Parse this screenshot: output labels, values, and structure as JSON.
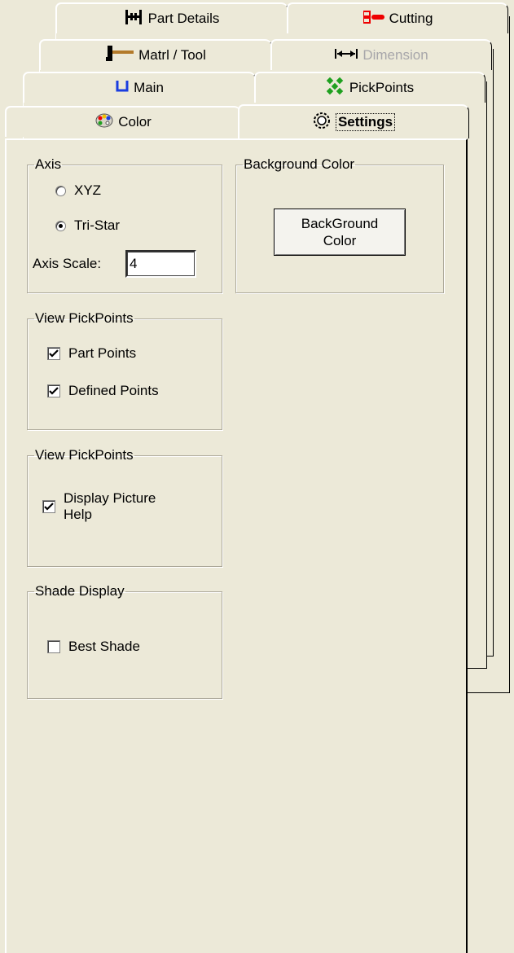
{
  "tabs": {
    "row1": [
      {
        "label": "Part Details",
        "icon": "part-details-icon",
        "disabled": false
      },
      {
        "label": "Cutting",
        "icon": "cutting-icon",
        "disabled": false
      }
    ],
    "row2": [
      {
        "label": "Matrl / Tool",
        "icon": "hammer-icon",
        "disabled": false
      },
      {
        "label": "Dimension",
        "icon": "dimension-icon",
        "disabled": true
      }
    ],
    "row3": [
      {
        "label": "Main",
        "icon": "main-icon",
        "disabled": false
      },
      {
        "label": "PickPoints",
        "icon": "pickpoints-icon",
        "disabled": false
      }
    ],
    "row4": [
      {
        "label": "Color",
        "icon": "palette-icon",
        "disabled": false
      },
      {
        "label": "Settings",
        "icon": "settings-icon",
        "active": true
      }
    ]
  },
  "axis": {
    "legend": "Axis",
    "options": [
      {
        "label": "XYZ",
        "selected": false
      },
      {
        "label": "Tri-Star",
        "selected": true
      }
    ],
    "scale_label": "Axis Scale:",
    "scale_value": "4"
  },
  "background": {
    "legend": "Background Color",
    "button_line1": "BackGround",
    "button_line2": "Color"
  },
  "view_pickpoints": {
    "legend": "View PickPoints",
    "items": [
      {
        "label": "Part Points",
        "checked": true
      },
      {
        "label": "Defined Points",
        "checked": true
      }
    ]
  },
  "view_help": {
    "legend": "View PickPoints",
    "label_line1": "Display Picture",
    "label_line2": "Help",
    "checked": true
  },
  "shade": {
    "legend": "Shade Display",
    "label": "Best Shade",
    "checked": false
  }
}
